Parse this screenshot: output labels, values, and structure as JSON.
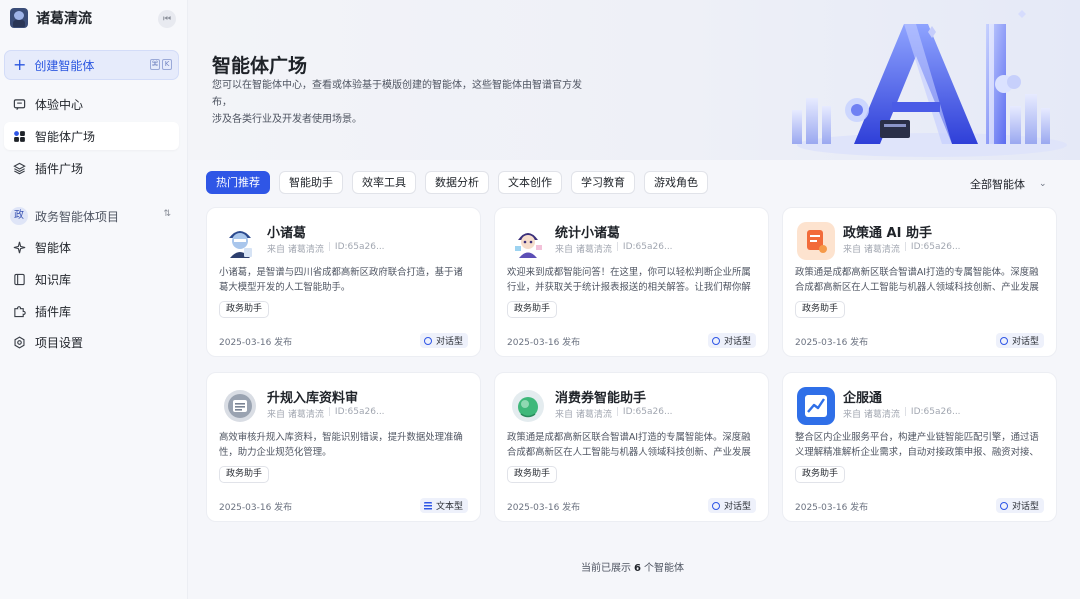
{
  "sidebar": {
    "brand": "诸葛清流",
    "create_label": "创建智能体",
    "nav": [
      {
        "label": "体验中心",
        "icon": "chat-icon"
      },
      {
        "label": "智能体广场",
        "icon": "grid-icon"
      },
      {
        "label": "插件广场",
        "icon": "layers-icon"
      }
    ],
    "project": {
      "avatar": "政",
      "label": "政务智能体项目"
    },
    "project_nav": [
      {
        "label": "智能体",
        "icon": "sparkle-icon"
      },
      {
        "label": "知识库",
        "icon": "book-icon"
      },
      {
        "label": "插件库",
        "icon": "puzzle-icon"
      },
      {
        "label": "项目设置",
        "icon": "gear-icon"
      }
    ]
  },
  "hero": {
    "title": "智能体广场",
    "desc_line1": "您可以在智能体中心，查看或体验基于模版创建的智能体，这些智能体由智谱官方发布，",
    "desc_line2": "涉及各类行业及开发者使用场景。"
  },
  "tabs": [
    "热门推荐",
    "智能助手",
    "效率工具",
    "数据分析",
    "文本创作",
    "学习教育",
    "游戏角色"
  ],
  "filter_label": "全部智能体",
  "cards": [
    {
      "name": "小诸葛",
      "source": "来自 诸葛清流",
      "id": "ID:65a26...",
      "desc": "小诸葛，是智谱与四川省成都高新区政府联合打造，基于诸葛大模型开发的人工智能助手。",
      "tag": "政务助手",
      "date": "2025-03-16 发布",
      "type": "对话型"
    },
    {
      "name": "统计小诸葛",
      "source": "来自 诸葛清流",
      "id": "ID:65a26...",
      "desc": "欢迎来到成都智能问答！在这里，你可以轻松判断企业所属行业，并获取关于统计报表报送的相关解答。让我们帮你解决...",
      "tag": "政务助手",
      "date": "2025-03-16 发布",
      "type": "对话型"
    },
    {
      "name": "政策通 AI 助手",
      "source": "来自 诸葛清流",
      "id": "ID:65a26...",
      "desc": "政策通是成都高新区联合智谱AI打造的专属智能体。深度融合成都高新区在人工智能与机器人领域科技创新、产业发展等...",
      "tag": "政务助手",
      "date": "2025-03-16 发布",
      "type": "对话型"
    },
    {
      "name": "升规入库资料审",
      "source": "来自 诸葛清流",
      "id": "ID:65a26...",
      "desc": "高效审核升规入库资料，智能识别错误，提升数据处理准确性，助力企业规范化管理。",
      "tag": "政务助手",
      "date": "2025-03-16 发布",
      "type": "文本型"
    },
    {
      "name": "消费券智能助手",
      "source": "来自 诸葛清流",
      "id": "ID:65a26...",
      "desc": "政策通是成都高新区联合智谱AI打造的专属智能体。深度融合成都高新区在人工智能与机器人领域科技创新、产业发展等...",
      "tag": "政务助手",
      "date": "2025-03-16 发布",
      "type": "对话型"
    },
    {
      "name": "企服通",
      "source": "来自 诸葛清流",
      "id": "ID:65a26...",
      "desc": "整合区内企业服务平台，构建产业链智能匹配引擎，通过语义理解精准解析企业需求，自动对接政策申报、融资对接、技...",
      "tag": "政务助手",
      "date": "2025-03-16 发布",
      "type": "对话型"
    }
  ],
  "footer": {
    "prefix": "当前已展示",
    "count": "6",
    "suffix": "个智能体"
  }
}
